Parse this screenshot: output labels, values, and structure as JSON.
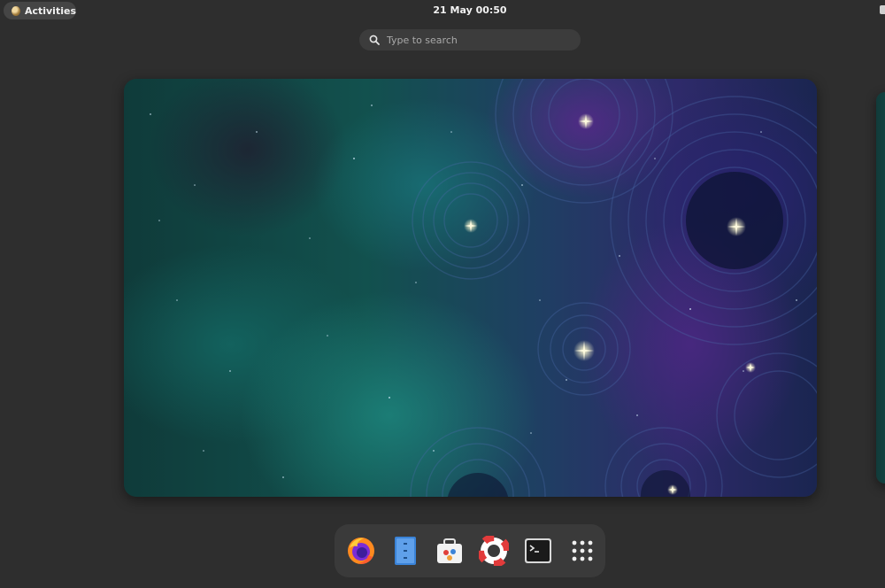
{
  "topbar": {
    "activities_label": "Activities",
    "clock": "21 May  00:50"
  },
  "search": {
    "placeholder": "Type to search"
  },
  "workspace": {
    "wallpaper": "nebula-starry-swirl"
  },
  "dock": {
    "items": [
      {
        "name": "firefox-icon"
      },
      {
        "name": "files-icon"
      },
      {
        "name": "software-center-icon"
      },
      {
        "name": "help-icon"
      },
      {
        "name": "terminal-icon"
      },
      {
        "name": "app-grid-icon"
      }
    ]
  },
  "colors": {
    "background": "#2e2e2e",
    "panel": "#3a3a3a",
    "accent_blue": "#3a83d8",
    "firefox_orange": "#ff8a1f"
  }
}
